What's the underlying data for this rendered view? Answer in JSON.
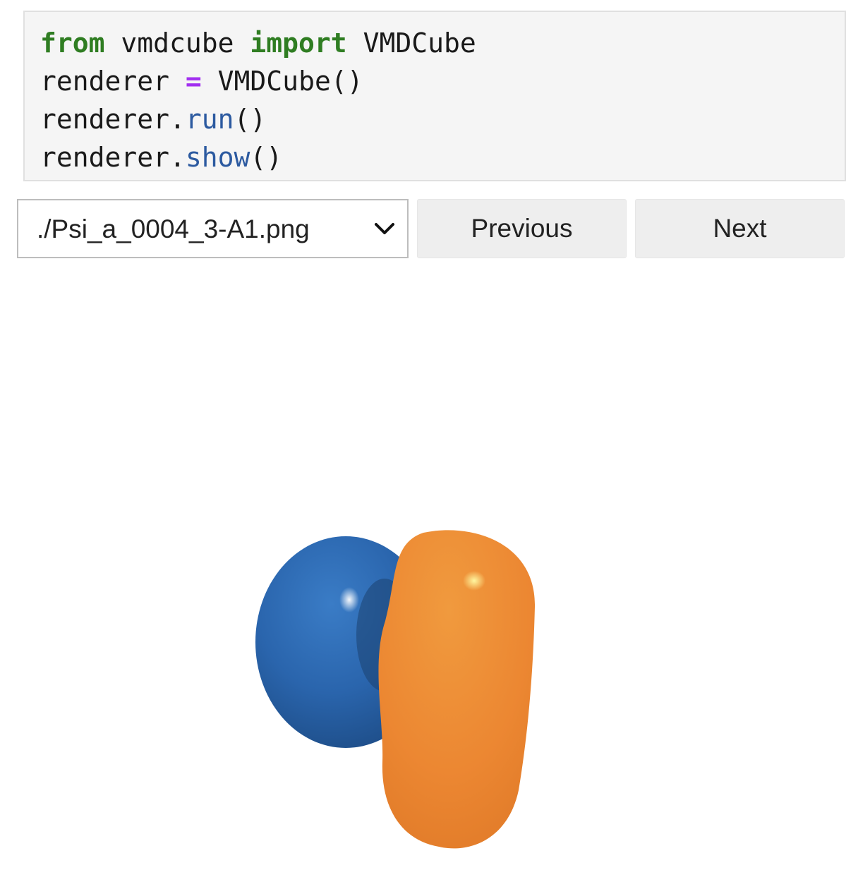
{
  "code_cell": {
    "lines": [
      [
        {
          "text": "from",
          "kind": "keyword"
        },
        {
          "text": " vmdcube ",
          "kind": "plain"
        },
        {
          "text": "import",
          "kind": "keyword"
        },
        {
          "text": " VMDCube",
          "kind": "plain"
        }
      ],
      [
        {
          "text": "renderer ",
          "kind": "plain"
        },
        {
          "text": "=",
          "kind": "operator"
        },
        {
          "text": " VMDCube()",
          "kind": "plain"
        }
      ],
      [
        {
          "text": "renderer.",
          "kind": "plain"
        },
        {
          "text": "run",
          "kind": "function"
        },
        {
          "text": "()",
          "kind": "plain"
        }
      ],
      [
        {
          "text": "renderer.",
          "kind": "plain"
        },
        {
          "text": "show",
          "kind": "function"
        },
        {
          "text": "()",
          "kind": "plain"
        }
      ]
    ]
  },
  "widgets": {
    "file_select": {
      "selected": "./Psi_a_0004_3-A1.png",
      "icon": "chevron-down-icon"
    },
    "previous_label": "Previous",
    "next_label": "Next"
  },
  "image": {
    "lobe_colors": {
      "negative": "#2a65ad",
      "positive": "#ec8732"
    }
  },
  "colors": {
    "keyword": "#2f7d22",
    "operator": "#a22ff0",
    "function": "#2c5aa0"
  }
}
